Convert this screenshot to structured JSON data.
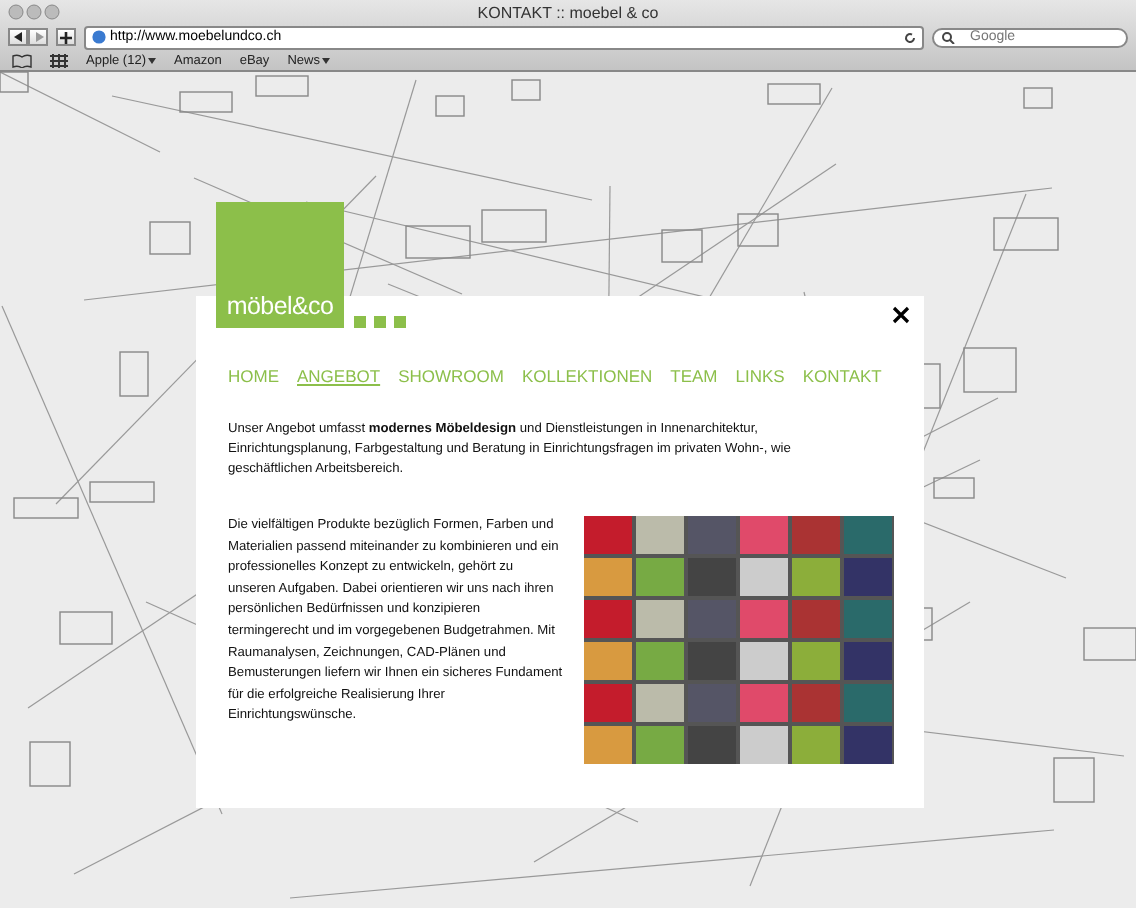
{
  "window": {
    "title": "KONTAKT :: moebel & co"
  },
  "toolbar": {
    "url": "http://www.moebelundco.ch",
    "search": {
      "placeholder": "Google"
    }
  },
  "bookmarks": [
    {
      "label": "Apple (12)",
      "has_menu": true
    },
    {
      "label": "Amazon",
      "has_menu": false
    },
    {
      "label": "eBay",
      "has_menu": false
    },
    {
      "label": "News",
      "has_menu": true
    }
  ],
  "site": {
    "logo": "möbel&co",
    "nav": [
      {
        "label": "HOME",
        "selected": false
      },
      {
        "label": "ANGEBOT",
        "selected": true
      },
      {
        "label": "SHOWROOM",
        "selected": false
      },
      {
        "label": "KOLLEKTIONEN",
        "selected": false
      },
      {
        "label": "TEAM",
        "selected": false
      },
      {
        "label": "LINKS",
        "selected": false
      },
      {
        "label": "KONTAKT",
        "selected": false
      }
    ],
    "intro": "Unser Angebot umfasst **modernes Möbeldesign** und Dienstleistungen in Innenarchitektur, Einrichtungsplanung, Farbgestaltung und Beratung in Einrichtungsfragen im privaten Wohn-, wie geschäftlichen Arbeitsbereich.",
    "body": "Die vielfältigen Produkte bezüglich Formen, Farben und Materialien passend miteinander zu kombinieren und ein professionelles Konzept zu entwickeln, gehört zu unseren Aufgaben. Dabei orientieren wir uns nach ihren persönlichen Bedürfnissen und konzipieren termingerecht und im vorgegebenen Budgetrahmen. Mit Raumanalysen, Zeichnungen, CAD-Plänen und Bemusterungen liefern wir Ihnen ein sicheres Fundament für die erfolgreiche Realisierung Ihrer Einrichtungswünsche."
  }
}
